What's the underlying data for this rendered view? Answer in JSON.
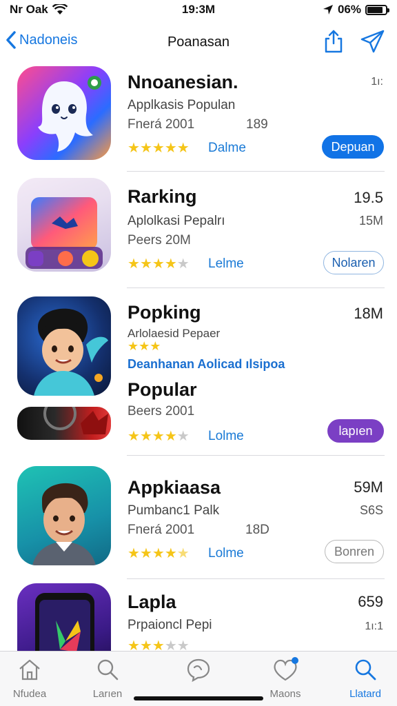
{
  "status": {
    "carrier": "Nr Oak",
    "time": "19:3M",
    "battery": "06%",
    "battery_level": 0.86
  },
  "nav": {
    "back_label": "Nadoneis",
    "title": "Poanasan"
  },
  "apps": [
    {
      "name": "Nnoanesian.",
      "subtitle": "Applkasis Populan",
      "meta": "Fnerá 2001",
      "meta2": "189",
      "size": "",
      "size_small": "1ı:",
      "rating": 5,
      "rating_label": "Dalme",
      "button": "Depuan",
      "button_style": "blue"
    },
    {
      "name": "Rarking",
      "subtitle": "Aplolkasi Pepalrı",
      "meta": "Peers 20M",
      "size": "19.5",
      "size_small": "15M",
      "rating": 4,
      "rating_label": "Lelme",
      "button": "Nolaren",
      "button_style": "outline"
    },
    {
      "name": "Popking",
      "subtitle": "Arlolaesid Pepaer",
      "blue_text": "Deanhanan Aolicad ılsipoa",
      "name2": "Popular",
      "meta": "Beers 2001",
      "size": "18M",
      "rating": 4,
      "rating_label": "Lolme",
      "button": "lapıen",
      "button_style": "purple"
    },
    {
      "name": "Appkiaasa",
      "subtitle": "Pumbanc1 Palk",
      "meta": "Fnerá 2001",
      "meta2": "18D",
      "size": "59M",
      "size_small": "S6S",
      "rating": 4.5,
      "rating_label": "Lolme",
      "button": "Bonren",
      "button_style": "gray"
    },
    {
      "name": "Lapla",
      "subtitle": "Prpaioncl Pepi",
      "size": "659",
      "size_small": "1ı:1",
      "rating": 3
    }
  ],
  "tabs": [
    {
      "label": "Nfudea",
      "icon": "home-icon"
    },
    {
      "label": "Larıen",
      "icon": "search-icon"
    },
    {
      "label": "",
      "icon": "chat-icon"
    },
    {
      "label": "Maons",
      "icon": "heart-icon"
    },
    {
      "label": "Llatard",
      "icon": "search-active-icon"
    }
  ],
  "colors": {
    "accent": "#1677e0",
    "purple": "#7b3fc4",
    "star": "#f5c518"
  }
}
